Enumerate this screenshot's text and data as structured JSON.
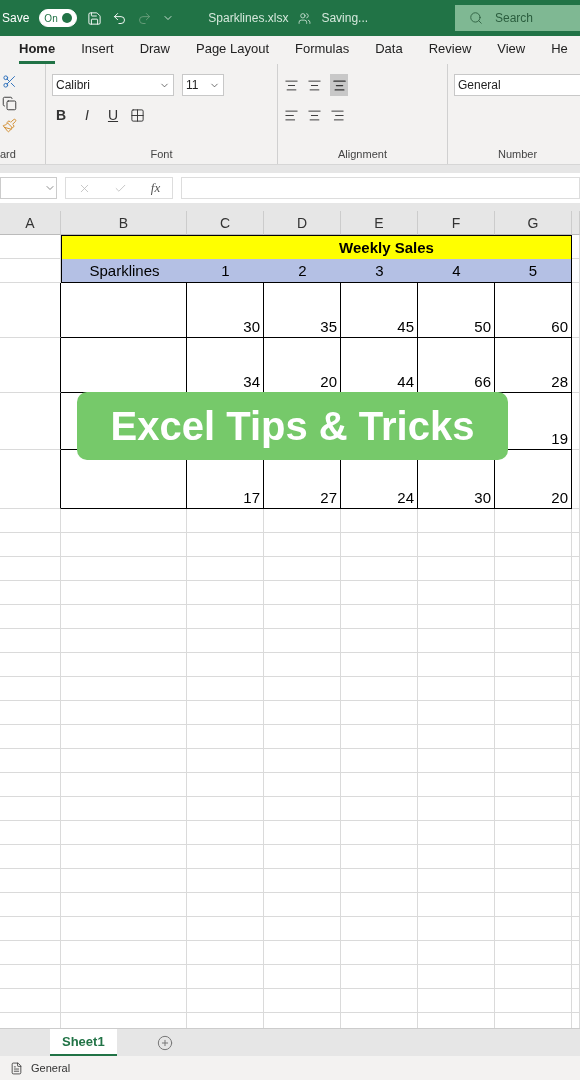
{
  "title_bar": {
    "autosave_label": "Save",
    "autosave": {
      "label": "On",
      "on": true
    },
    "filename": "Sparklines.xlsx",
    "status": "Saving...",
    "search": {
      "placeholder": "Search"
    }
  },
  "ribbon_tabs": [
    {
      "label": "Home",
      "selected": true
    },
    {
      "label": "Insert",
      "selected": false
    },
    {
      "label": "Draw",
      "selected": false
    },
    {
      "label": "Page Layout",
      "selected": false
    },
    {
      "label": "Formulas",
      "selected": false
    },
    {
      "label": "Data",
      "selected": false
    },
    {
      "label": "Review",
      "selected": false
    },
    {
      "label": "View",
      "selected": false
    },
    {
      "label": "He",
      "selected": false
    }
  ],
  "ribbon": {
    "font_name": "Calibri",
    "font_size": "11",
    "font_buttons": [
      "B",
      "I",
      "U"
    ],
    "number_format": "General",
    "groups": [
      "ard",
      "Font",
      "Alignment",
      "Number"
    ]
  },
  "formula_bar": {
    "fx": "fx"
  },
  "columns": [
    "A",
    "B",
    "C",
    "D",
    "E",
    "F",
    "G"
  ],
  "sheet": {
    "title": "Weekly Sales",
    "header_label": "Sparklines",
    "weeks": [
      "1",
      "2",
      "3",
      "4",
      "5"
    ],
    "rows": [
      {
        "values": {
          "C": "30",
          "D": "35",
          "E": "45",
          "F": "50",
          "G": "60"
        }
      },
      {
        "values": {
          "C": "34",
          "D": "20",
          "E": "44",
          "F": "66",
          "G": "28"
        }
      },
      {
        "values": {
          "G": "19"
        }
      },
      {
        "values": {
          "C": "17",
          "D": "27",
          "E": "24",
          "F": "30",
          "G": "20"
        }
      }
    ]
  },
  "overlay": {
    "text": "Excel Tips & Tricks"
  },
  "sheet_tabs": [
    {
      "label": "Sheet1",
      "selected": true
    }
  ],
  "status_bar": {
    "text": "General"
  }
}
